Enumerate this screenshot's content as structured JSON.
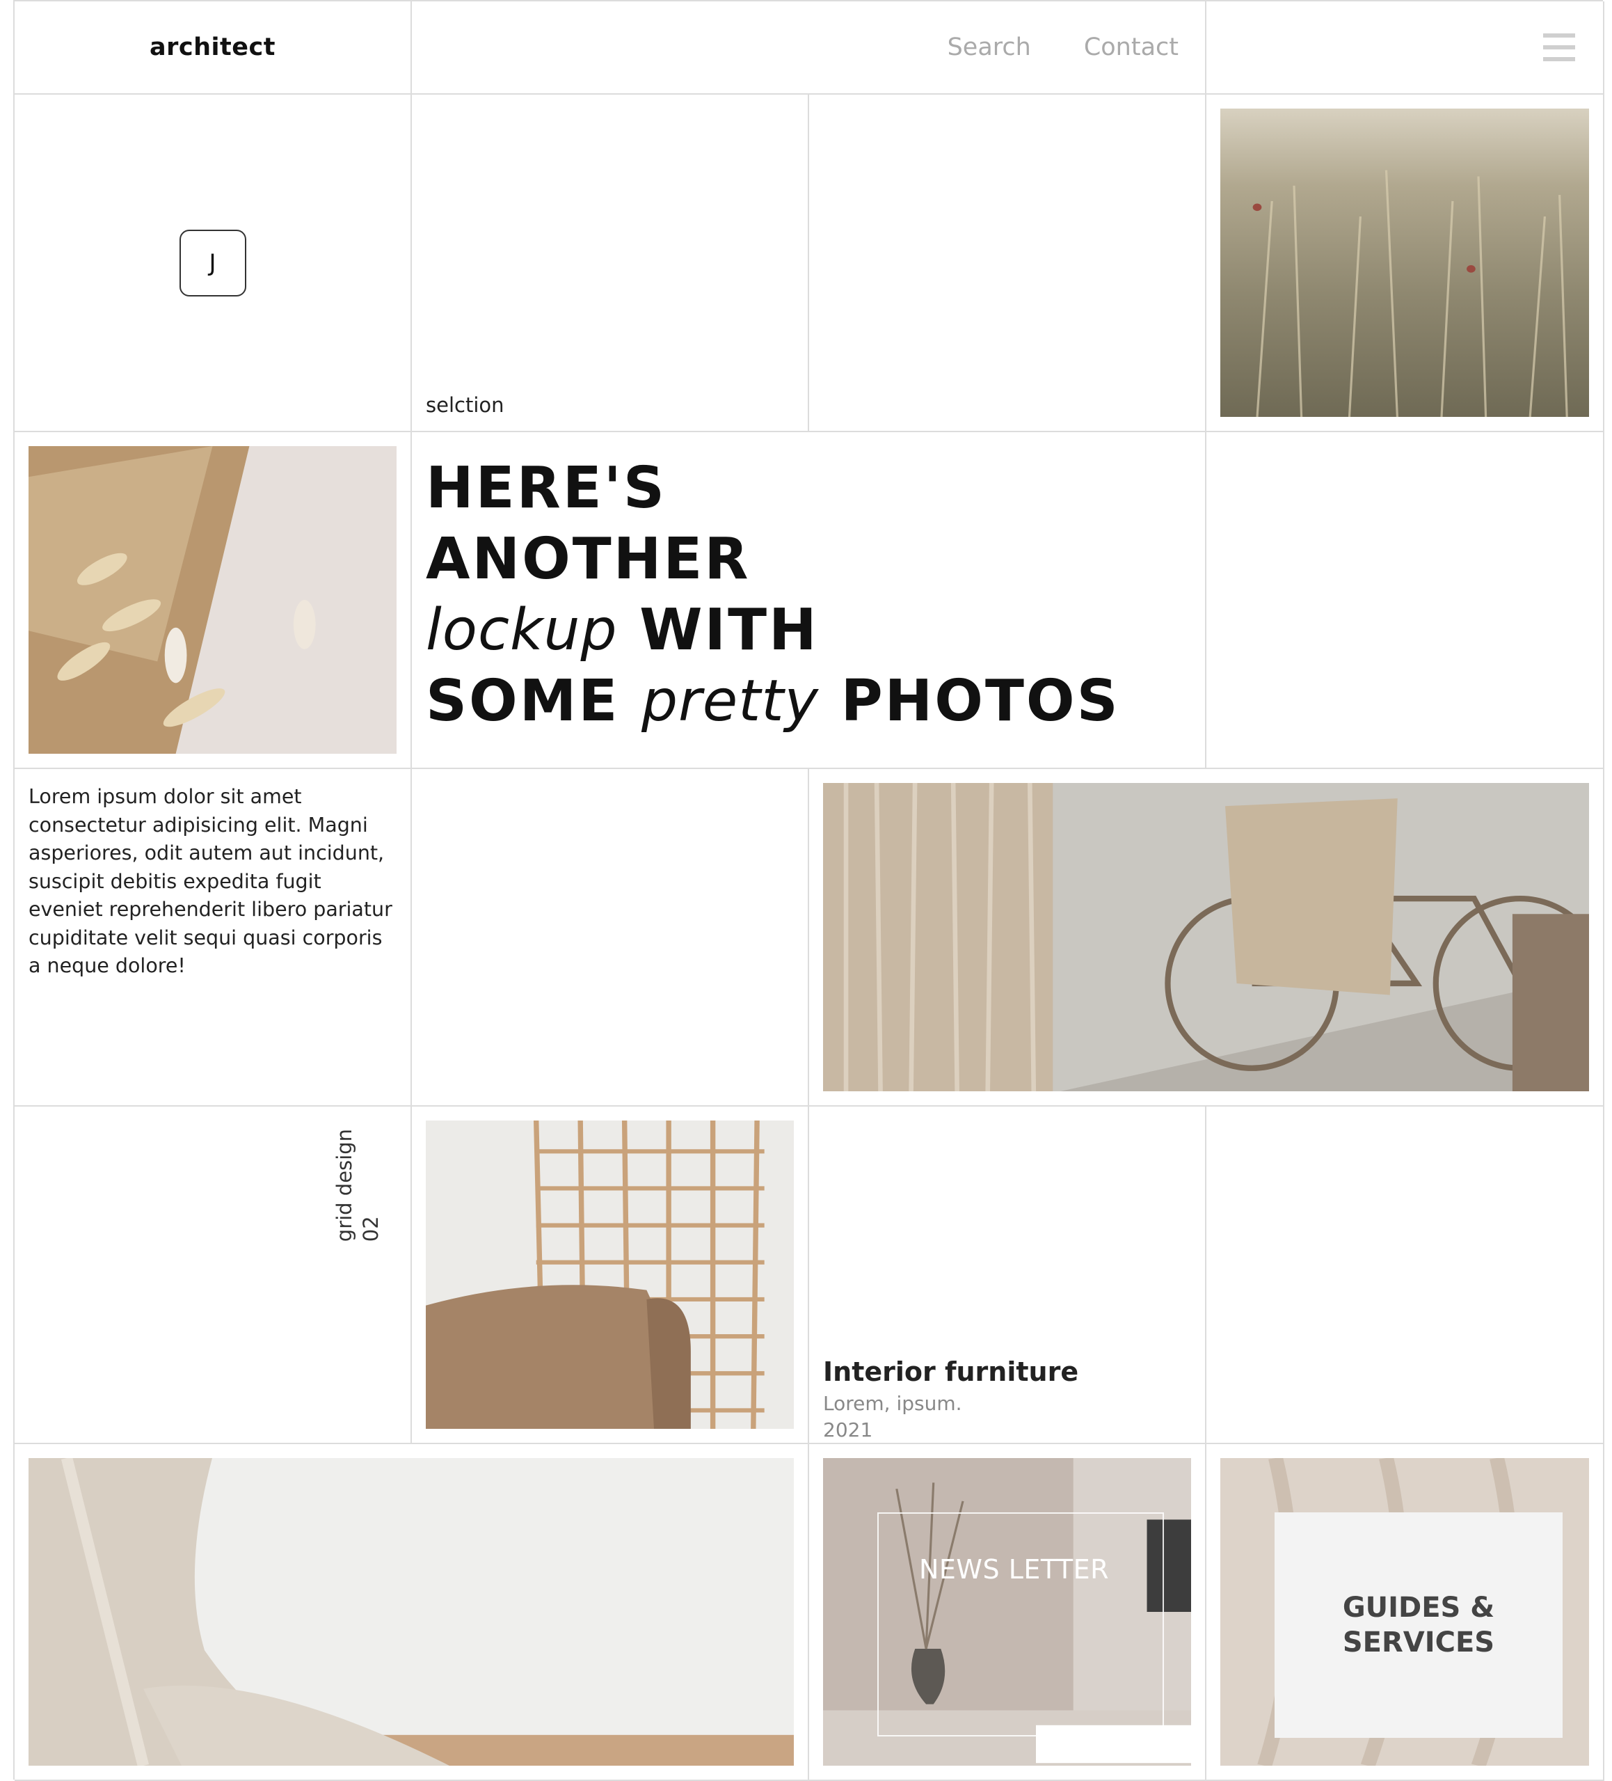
{
  "header": {
    "logo": "architect",
    "nav": [
      {
        "label": "Search"
      },
      {
        "label": "Contact"
      }
    ],
    "menu_icon": "hamburger-menu-icon"
  },
  "intro": {
    "avatar_letter": "J",
    "selection_label": "selction"
  },
  "headline": {
    "line1": "HERE'S",
    "line2": "ANOTHER",
    "line3_italic": "lockup",
    "line3_rest": "WITH",
    "line4_start": "SOME",
    "line4_italic": "pretty",
    "line4_end": "PHOTOS"
  },
  "body_text": "Lorem ipsum dolor sit amet consectetur adipisicing elit. Magni asperiores, odit autem aut incidunt, suscipit debitis expedita fugit eveniet reprehenderit libero pariatur cupiditate velit sequi quasi corporis a neque dolore!",
  "grid_label": {
    "line1": "grid design",
    "line2": "02"
  },
  "feature": {
    "title": "Interior furniture",
    "subtitle": "Lorem, ipsum.",
    "year": "2021"
  },
  "newsletter": {
    "title": "NEWS LETTER",
    "arrow_icon": "arrow-right-icon"
  },
  "guides": {
    "line1": "GUIDES &",
    "line2": "SERVICES"
  },
  "colors": {
    "grid_line": "#dcdcdc",
    "nav_text": "#aaaaaa",
    "muted_text": "#888888"
  }
}
